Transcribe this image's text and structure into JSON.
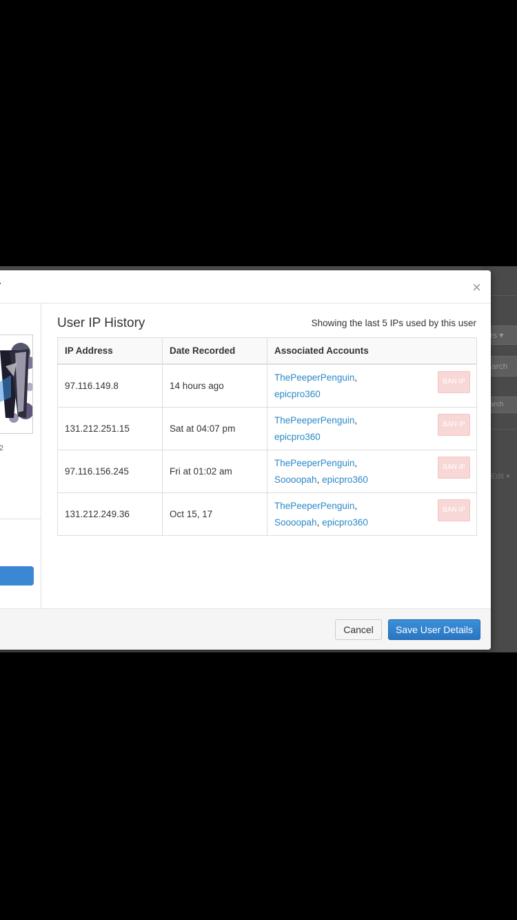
{
  "background": {
    "filter_label": "rs",
    "search_label": "arch",
    "search_small_label": "arch",
    "edit_label": "Edit"
  },
  "modal": {
    "title": "r",
    "close_label": "×",
    "left": {
      "caption": "2"
    },
    "ip_history": {
      "title": "User IP History",
      "note": "Showing the last 5 IPs used by this user",
      "columns": [
        "IP Address",
        "Date Recorded",
        "Associated Accounts"
      ],
      "ban_label": "BAN IP",
      "rows": [
        {
          "ip": "97.116.149.8",
          "date": "14 hours ago",
          "accounts": [
            "ThePeeperPenguin",
            "epicpro360"
          ]
        },
        {
          "ip": "131.212.251.15",
          "date": "Sat at 04:07 pm",
          "accounts": [
            "ThePeeperPenguin",
            "epicpro360"
          ]
        },
        {
          "ip": "97.116.156.245",
          "date": "Fri at 01:02 am",
          "accounts": [
            "ThePeeperPenguin",
            "Soooopah",
            "epicpro360"
          ]
        },
        {
          "ip": "131.212.249.36",
          "date": "Oct 15, 17",
          "accounts": [
            "ThePeeperPenguin",
            "Soooopah",
            "epicpro360"
          ]
        }
      ]
    },
    "footer": {
      "cancel_label": "Cancel",
      "save_label": "Save User Details"
    }
  }
}
